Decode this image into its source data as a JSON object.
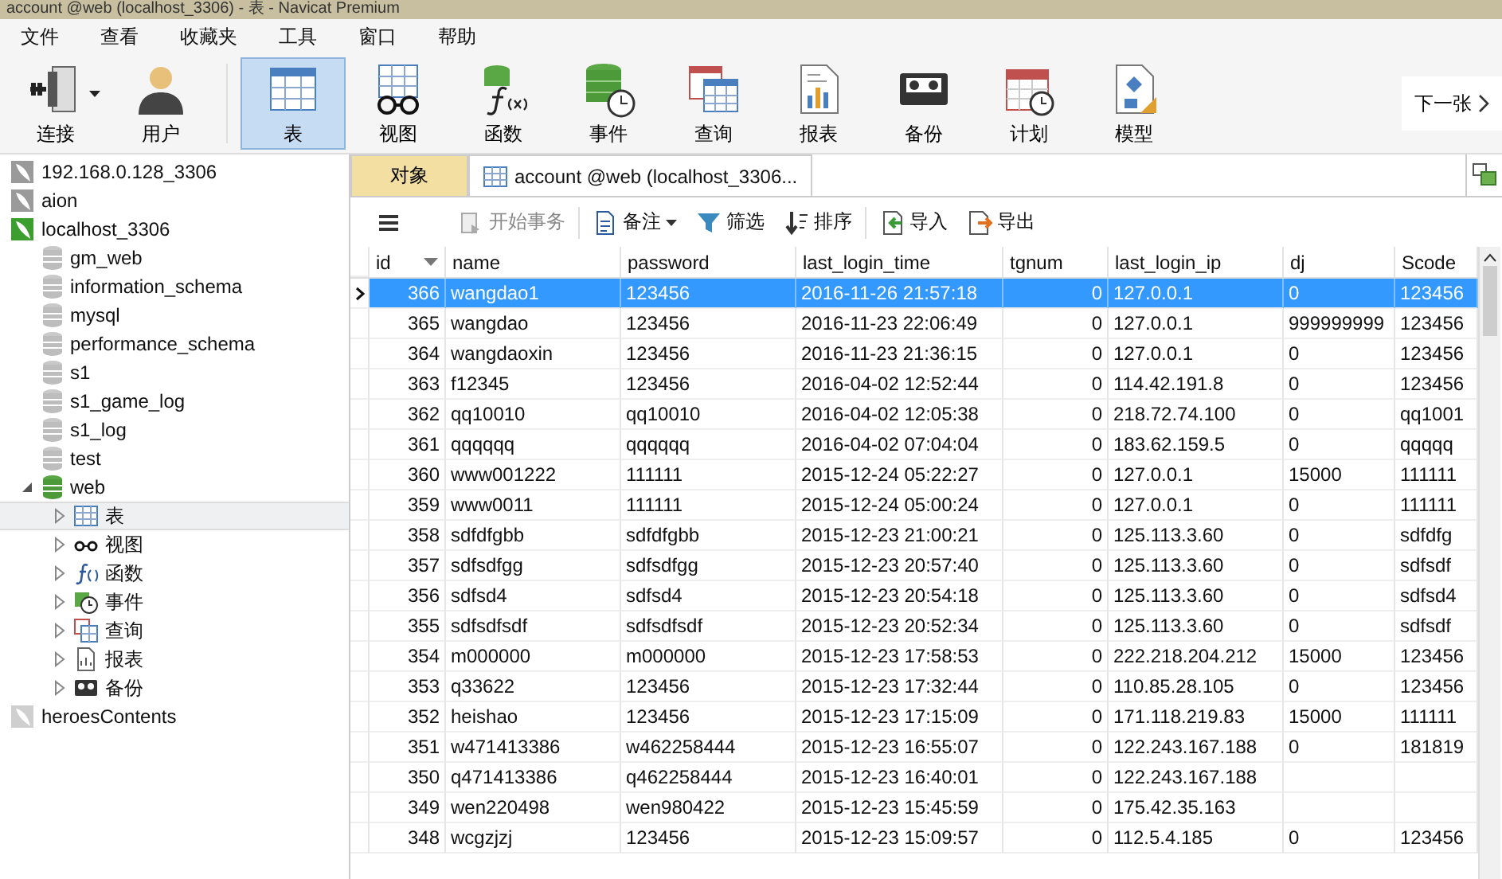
{
  "window": {
    "title": "account @web (localhost_3306) - 表 - Navicat Premium"
  },
  "menu": [
    "文件",
    "查看",
    "收藏夹",
    "工具",
    "窗口",
    "帮助"
  ],
  "ribbon": [
    {
      "kind": "connection",
      "label": "连接",
      "selected": false,
      "dropdown": true
    },
    {
      "kind": "user",
      "label": "用户",
      "selected": false,
      "dropdown": false
    },
    {
      "kind": "table",
      "label": "表",
      "selected": true,
      "dropdown": false
    },
    {
      "kind": "view",
      "label": "视图",
      "selected": false,
      "dropdown": false
    },
    {
      "kind": "function",
      "label": "函数",
      "selected": false,
      "dropdown": false
    },
    {
      "kind": "event",
      "label": "事件",
      "selected": false,
      "dropdown": false
    },
    {
      "kind": "query",
      "label": "查询",
      "selected": false,
      "dropdown": false
    },
    {
      "kind": "report",
      "label": "报表",
      "selected": false,
      "dropdown": false
    },
    {
      "kind": "backup",
      "label": "备份",
      "selected": false,
      "dropdown": false
    },
    {
      "kind": "schedule",
      "label": "计划",
      "selected": false,
      "dropdown": false
    },
    {
      "kind": "model",
      "label": "模型",
      "selected": false,
      "dropdown": false
    }
  ],
  "next_button": "下一张",
  "sidebar": {
    "connections": [
      {
        "name": "192.168.0.128_3306",
        "color": "#9a9a9a"
      },
      {
        "name": "aion",
        "color": "#9a9a9a"
      },
      {
        "name": "localhost_3306",
        "color": "#3c9e2e",
        "children": [
          {
            "name": "gm_web",
            "expanded": false
          },
          {
            "name": "information_schema",
            "expanded": false
          },
          {
            "name": "mysql",
            "expanded": false
          },
          {
            "name": "performance_schema",
            "expanded": false
          },
          {
            "name": "s1",
            "expanded": false
          },
          {
            "name": "s1_game_log",
            "expanded": false
          },
          {
            "name": "s1_log",
            "expanded": false
          },
          {
            "name": "test",
            "expanded": false
          },
          {
            "name": "web",
            "expanded": true,
            "children": [
              {
                "kind": "table",
                "label": "表",
                "selected": true
              },
              {
                "kind": "view",
                "label": "视图",
                "selected": false
              },
              {
                "kind": "function",
                "label": "函数",
                "selected": false
              },
              {
                "kind": "event",
                "label": "事件",
                "selected": false
              },
              {
                "kind": "query",
                "label": "查询",
                "selected": false
              },
              {
                "kind": "report",
                "label": "报表",
                "selected": false
              },
              {
                "kind": "backup",
                "label": "备份",
                "selected": false
              }
            ]
          }
        ]
      },
      {
        "name": "heroesContents",
        "color": "#cfcfcf"
      }
    ]
  },
  "tabs": [
    {
      "kind": "objects",
      "label": "对象",
      "selected": false
    },
    {
      "kind": "table",
      "label": "account @web (localhost_3306...",
      "selected": true
    }
  ],
  "toolbar": [
    {
      "kind": "menu"
    },
    {
      "kind": "transaction",
      "label": "开始事务",
      "disabled": true,
      "dropdown": false
    },
    {
      "kind": "note",
      "label": "备注",
      "disabled": false,
      "dropdown": true
    },
    {
      "kind": "filter",
      "label": "筛选",
      "disabled": false,
      "dropdown": false
    },
    {
      "kind": "sort",
      "label": "排序",
      "disabled": false,
      "dropdown": false
    },
    {
      "kind": "import",
      "label": "导入",
      "disabled": false,
      "dropdown": false
    },
    {
      "kind": "export",
      "label": "导出",
      "disabled": false,
      "dropdown": false
    }
  ],
  "table": {
    "columns": [
      {
        "label": "id",
        "sorted": true
      },
      {
        "label": "name",
        "sorted": false
      },
      {
        "label": "password",
        "sorted": false
      },
      {
        "label": "last_login_time",
        "sorted": false
      },
      {
        "label": "tgnum",
        "sorted": false
      },
      {
        "label": "last_login_ip",
        "sorted": false
      },
      {
        "label": "dj",
        "sorted": false
      },
      {
        "label": "Scode",
        "sorted": false
      }
    ],
    "rows": [
      {
        "selected": true,
        "cells": [
          "366",
          "wangdao1",
          "123456",
          "2016-11-26 21:57:18",
          "0",
          "127.0.0.1",
          "0",
          "123456"
        ]
      },
      {
        "selected": false,
        "cells": [
          "365",
          "wangdao",
          "123456",
          "2016-11-23 22:06:49",
          "0",
          "127.0.0.1",
          "999999999",
          "123456"
        ]
      },
      {
        "selected": false,
        "cells": [
          "364",
          "wangdaoxin",
          "123456",
          "2016-11-23 21:36:15",
          "0",
          "127.0.0.1",
          "0",
          "123456"
        ]
      },
      {
        "selected": false,
        "cells": [
          "363",
          "f12345",
          "123456",
          "2016-04-02 12:52:44",
          "0",
          "114.42.191.8",
          "0",
          "123456"
        ]
      },
      {
        "selected": false,
        "cells": [
          "362",
          "qq10010",
          "qq10010",
          "2016-04-02 12:05:38",
          "0",
          "218.72.74.100",
          "0",
          "qq1001"
        ]
      },
      {
        "selected": false,
        "cells": [
          "361",
          "qqqqqq",
          "qqqqqq",
          "2016-04-02 07:04:04",
          "0",
          "183.62.159.5",
          "0",
          "qqqqq"
        ]
      },
      {
        "selected": false,
        "cells": [
          "360",
          "www001222",
          "111111",
          "2015-12-24 05:22:27",
          "0",
          "127.0.0.1",
          "15000",
          "111111"
        ]
      },
      {
        "selected": false,
        "cells": [
          "359",
          "www0011",
          "111111",
          "2015-12-24 05:00:24",
          "0",
          "127.0.0.1",
          "0",
          "111111"
        ]
      },
      {
        "selected": false,
        "cells": [
          "358",
          "sdfdfgbb",
          "sdfdfgbb",
          "2015-12-23 21:00:21",
          "0",
          "125.113.3.60",
          "0",
          "sdfdfg"
        ]
      },
      {
        "selected": false,
        "cells": [
          "357",
          "sdfsdfgg",
          "sdfsdfgg",
          "2015-12-23 20:57:40",
          "0",
          "125.113.3.60",
          "0",
          "sdfsdf"
        ]
      },
      {
        "selected": false,
        "cells": [
          "356",
          "sdfsd4",
          "sdfsd4",
          "2015-12-23 20:54:18",
          "0",
          "125.113.3.60",
          "0",
          "sdfsd4"
        ]
      },
      {
        "selected": false,
        "cells": [
          "355",
          "sdfsdfsdf",
          "sdfsdfsdf",
          "2015-12-23 20:52:34",
          "0",
          "125.113.3.60",
          "0",
          "sdfsdf"
        ]
      },
      {
        "selected": false,
        "cells": [
          "354",
          "m000000",
          "m000000",
          "2015-12-23 17:58:53",
          "0",
          "222.218.204.212",
          "15000",
          "123456"
        ]
      },
      {
        "selected": false,
        "cells": [
          "353",
          "q33622",
          "123456",
          "2015-12-23 17:32:44",
          "0",
          "110.85.28.105",
          "0",
          "123456"
        ]
      },
      {
        "selected": false,
        "cells": [
          "352",
          "heishao",
          "123456",
          "2015-12-23 17:15:09",
          "0",
          "171.118.219.83",
          "15000",
          "111111"
        ]
      },
      {
        "selected": false,
        "cells": [
          "351",
          "w471413386",
          "w462258444",
          "2015-12-23 16:55:07",
          "0",
          "122.243.167.188",
          "0",
          "181819"
        ]
      },
      {
        "selected": false,
        "cells": [
          "350",
          "q471413386",
          "q462258444",
          "2015-12-23 16:40:01",
          "0",
          "122.243.167.188"
        ]
      },
      {
        "selected": false,
        "cells": [
          "349",
          "wen220498",
          "wen980422",
          "2015-12-23 15:45:59",
          "0",
          "175.42.35.163"
        ]
      },
      {
        "selected": false,
        "cells": [
          "348",
          "wcgzjzj",
          "123456",
          "2015-12-23 15:09:57",
          "0",
          "112.5.4.185",
          "0",
          "123456"
        ]
      }
    ]
  }
}
